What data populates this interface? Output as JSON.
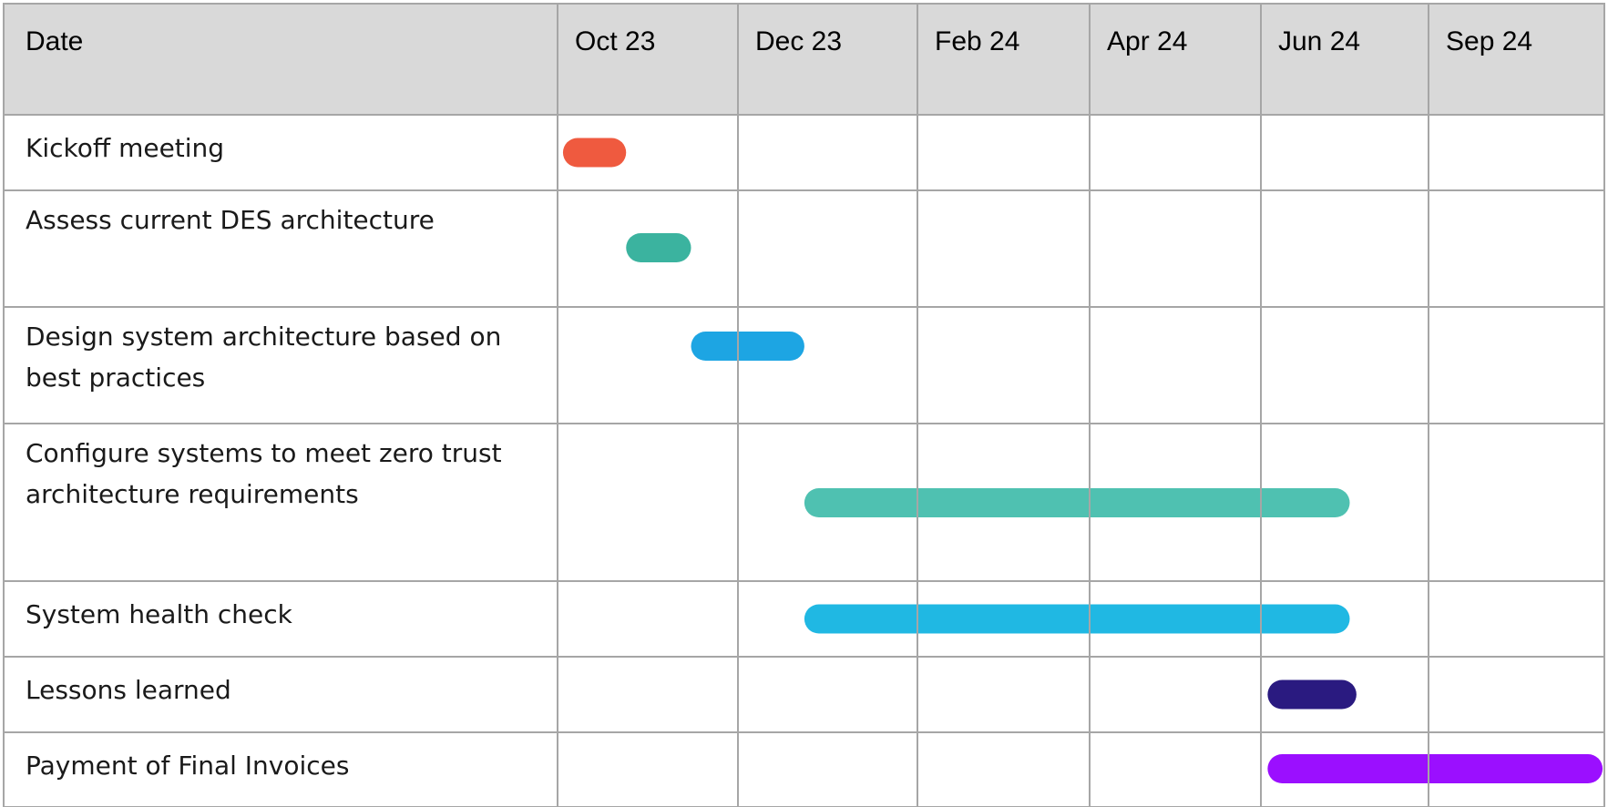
{
  "chart_data": {
    "type": "gantt",
    "header_label": "Date",
    "periods": [
      "Oct 23",
      "Dec 23",
      "Feb 24",
      "Apr 24",
      "Jun 24",
      "Sep 24"
    ],
    "tasks": [
      {
        "lines": [
          "Kickoff meeting"
        ],
        "start": 0.03,
        "end": 0.38,
        "color": "#ef5a3f"
      },
      {
        "lines": [
          "Assess current DES architecture"
        ],
        "start": 0.38,
        "end": 0.74,
        "color": "#3bb39f"
      },
      {
        "lines": [
          "Design system architecture based on",
          "best practices"
        ],
        "start": 0.74,
        "end": 1.37,
        "color": "#1da5e3"
      },
      {
        "lines": [
          "Configure systems to meet zero trust",
          "architecture requirements"
        ],
        "start": 1.37,
        "end": 4.53,
        "color": "#4fc1b1"
      },
      {
        "lines": [
          "System health check"
        ],
        "start": 1.37,
        "end": 4.53,
        "color": "#20b8e3"
      },
      {
        "lines": [
          "Lessons learned"
        ],
        "start": 4.04,
        "end": 4.57,
        "color": "#2a1a80"
      },
      {
        "lines": [
          "Payment of Final Invoices"
        ],
        "start": 4.04,
        "end": 5.99,
        "color": "#9b0fff"
      }
    ]
  }
}
